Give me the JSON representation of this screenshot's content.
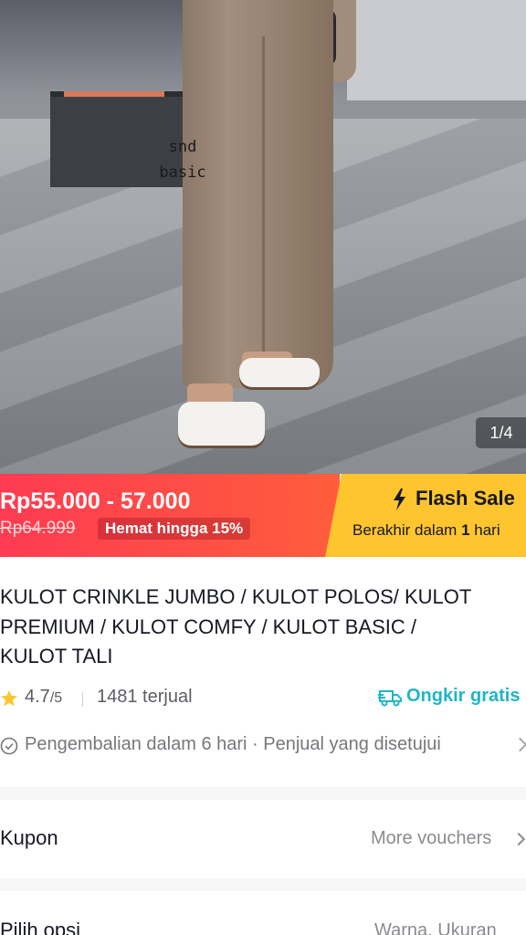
{
  "gallery": {
    "image_text_line1": "snd",
    "image_text_line2": "basic",
    "page_indicator": "1/4"
  },
  "price": {
    "range": "Rp55.000 - 57.000",
    "original": "Rp64.999",
    "savings": "Hemat hingga 15%"
  },
  "flash_sale": {
    "title": "Flash Sale",
    "ends_prefix": "Berakhir dalam",
    "ends_value": "1",
    "ends_unit": "hari"
  },
  "product": {
    "title_lines": [
      "KULOT CRINKLE JUMBO / KULOT POLOS/ KULOT",
      "PREMIUM / KULOT COMFY / KULOT BASIC /",
      "KULOT TALI"
    ]
  },
  "stats": {
    "rating": "4.7",
    "rating_max": "/5",
    "sold": "1481 terjual",
    "shipping": "Ongkir gratis"
  },
  "guarantee": {
    "text": "Pengembalian dalam 6 hari · Penjual yang disetujui"
  },
  "coupon": {
    "label": "Kupon",
    "link": "More vouchers"
  },
  "options": {
    "label": "Pilih opsi",
    "value": "Warna, Ukuran"
  },
  "colors": {
    "price_red": "#fe3b52",
    "flash_yellow": "#ffc52f",
    "shipping_teal": "#20b5c8",
    "star_yellow": "#fdc52b"
  },
  "icons": [
    "star-icon",
    "truck-icon",
    "check-circle-icon",
    "chevron-right-icon",
    "lightning-icon"
  ]
}
